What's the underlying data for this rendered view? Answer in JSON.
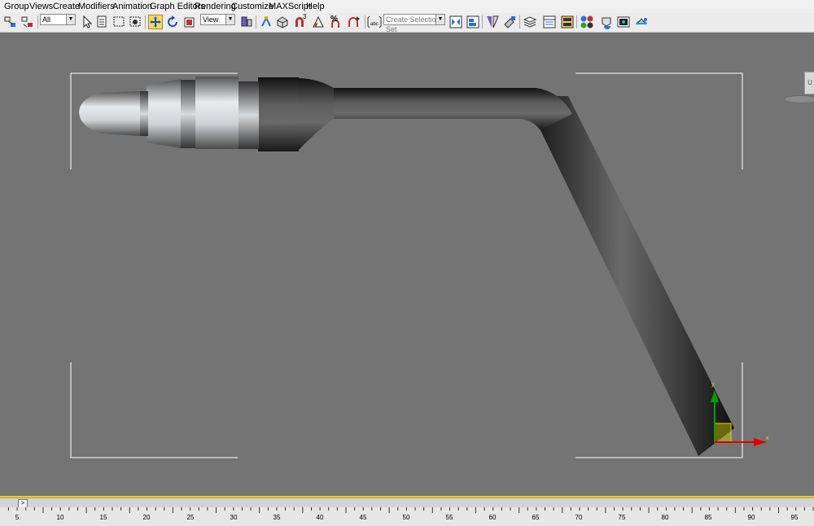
{
  "menu": {
    "items": [
      "Group",
      "Views",
      "Create",
      "Modifiers",
      "Animation",
      "Graph Editors",
      "Rendering",
      "Customize",
      "MAXScript",
      "Help"
    ]
  },
  "toolbar": {
    "selection_filter": "All",
    "reference_coordinate_system": "View",
    "named_selection_placeholder": "Create Selection Set",
    "snap_angle_label": "3",
    "percent_snap_label": "%"
  },
  "viewport": {
    "background": "#747474",
    "gizmo_colors": {
      "x_axis": "#e00000",
      "y_axis": "#00a000",
      "plane": "#d4c800"
    },
    "gizmo_labels": {
      "x": "x",
      "y": "y"
    },
    "corner_label": "U"
  },
  "timeline": {
    "arrow_label": ">",
    "ruler_ticks": [
      "5",
      "10",
      "15",
      "20",
      "25",
      "30",
      "35",
      "40",
      "45",
      "50",
      "55",
      "60",
      "65",
      "70",
      "75",
      "80",
      "85",
      "90",
      "95"
    ]
  }
}
